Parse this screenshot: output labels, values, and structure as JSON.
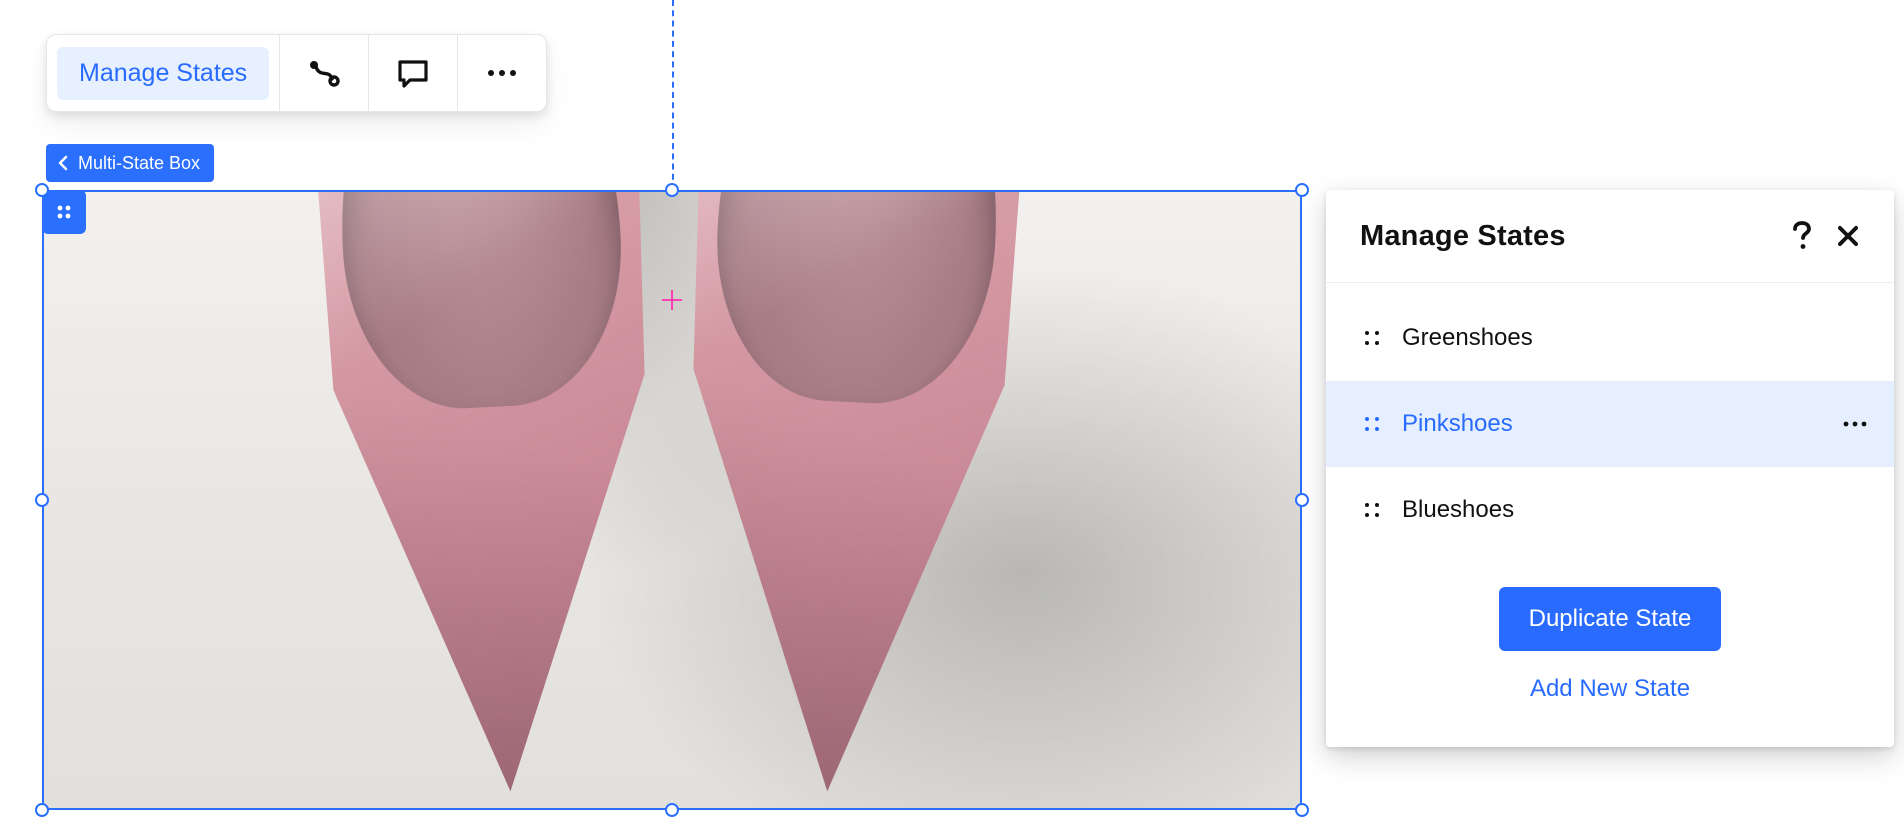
{
  "toolbar": {
    "manage_label": "Manage States"
  },
  "breadcrumb": {
    "label": "Multi-State Box"
  },
  "panel": {
    "title": "Manage States",
    "states": [
      {
        "label": "Greenshoes",
        "selected": false
      },
      {
        "label": "Pinkshoes",
        "selected": true
      },
      {
        "label": "Blueshoes",
        "selected": false
      }
    ],
    "duplicate_label": "Duplicate State",
    "add_label": "Add New State"
  }
}
